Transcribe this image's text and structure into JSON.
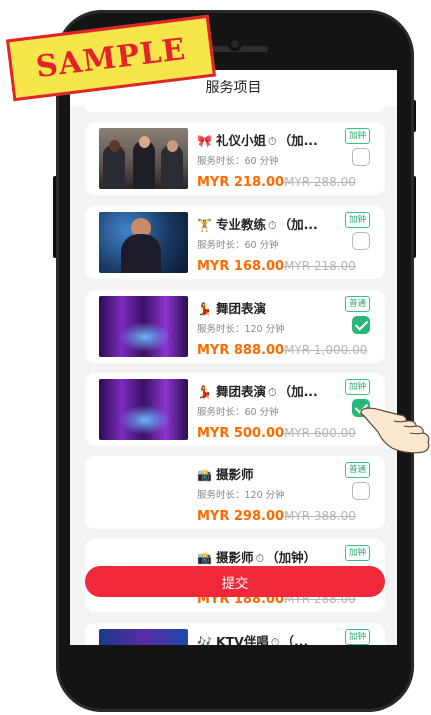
{
  "stamp": {
    "text": "SAMPLE"
  },
  "header": {
    "title": "服务项目"
  },
  "items": [
    {
      "name": "礼仪小姐",
      "emoji": "🎀",
      "addon": "（加...",
      "duration": "服务时长：60 分钟",
      "price": "MYR 218.00",
      "original": "MYR 288.00",
      "tag": "加钟",
      "selected": false
    },
    {
      "name": "专业教练",
      "emoji": "🏋",
      "addon": "（加...",
      "duration": "服务时长：60 分钟",
      "price": "MYR 168.00",
      "original": "MYR 218.00",
      "tag": "加钟",
      "selected": false
    },
    {
      "name": "舞团表演",
      "emoji": "💃",
      "addon": "",
      "duration": "服务时长：120 分钟",
      "price": "MYR 888.00",
      "original": "MYR 1,000.00",
      "tag": "普通",
      "selected": true
    },
    {
      "name": "舞团表演",
      "emoji": "💃",
      "addon": "（加...",
      "duration": "服务时长：60 分钟",
      "price": "MYR 500.00",
      "original": "MYR 600.00",
      "tag": "加钟",
      "selected": true
    },
    {
      "name": "摄影师",
      "emoji": "📸",
      "addon": "",
      "duration": "服务时长：120 分钟",
      "price": "MYR 298.00",
      "original": "MYR 388.00",
      "tag": "普通",
      "selected": false
    },
    {
      "name": "摄影师",
      "emoji": "📸",
      "addon": "（加钟）",
      "tag": "加钟",
      "price": "MYR 188.00",
      "original": "MYR 288.00"
    },
    {
      "name": "KTV伴唱",
      "emoji": "🎶",
      "addon": "（...",
      "tag": "加钟"
    }
  ],
  "submit": {
    "label": "提交"
  },
  "icons": {
    "back": "back-chevron-icon",
    "clock": "stopwatch-icon",
    "pointer": "pointing-hand-icon"
  },
  "colors": {
    "accent_price": "#ff6a00",
    "submit_bg": "#f0283a",
    "check_on": "#27b879",
    "tag_green": "#28a86c"
  }
}
